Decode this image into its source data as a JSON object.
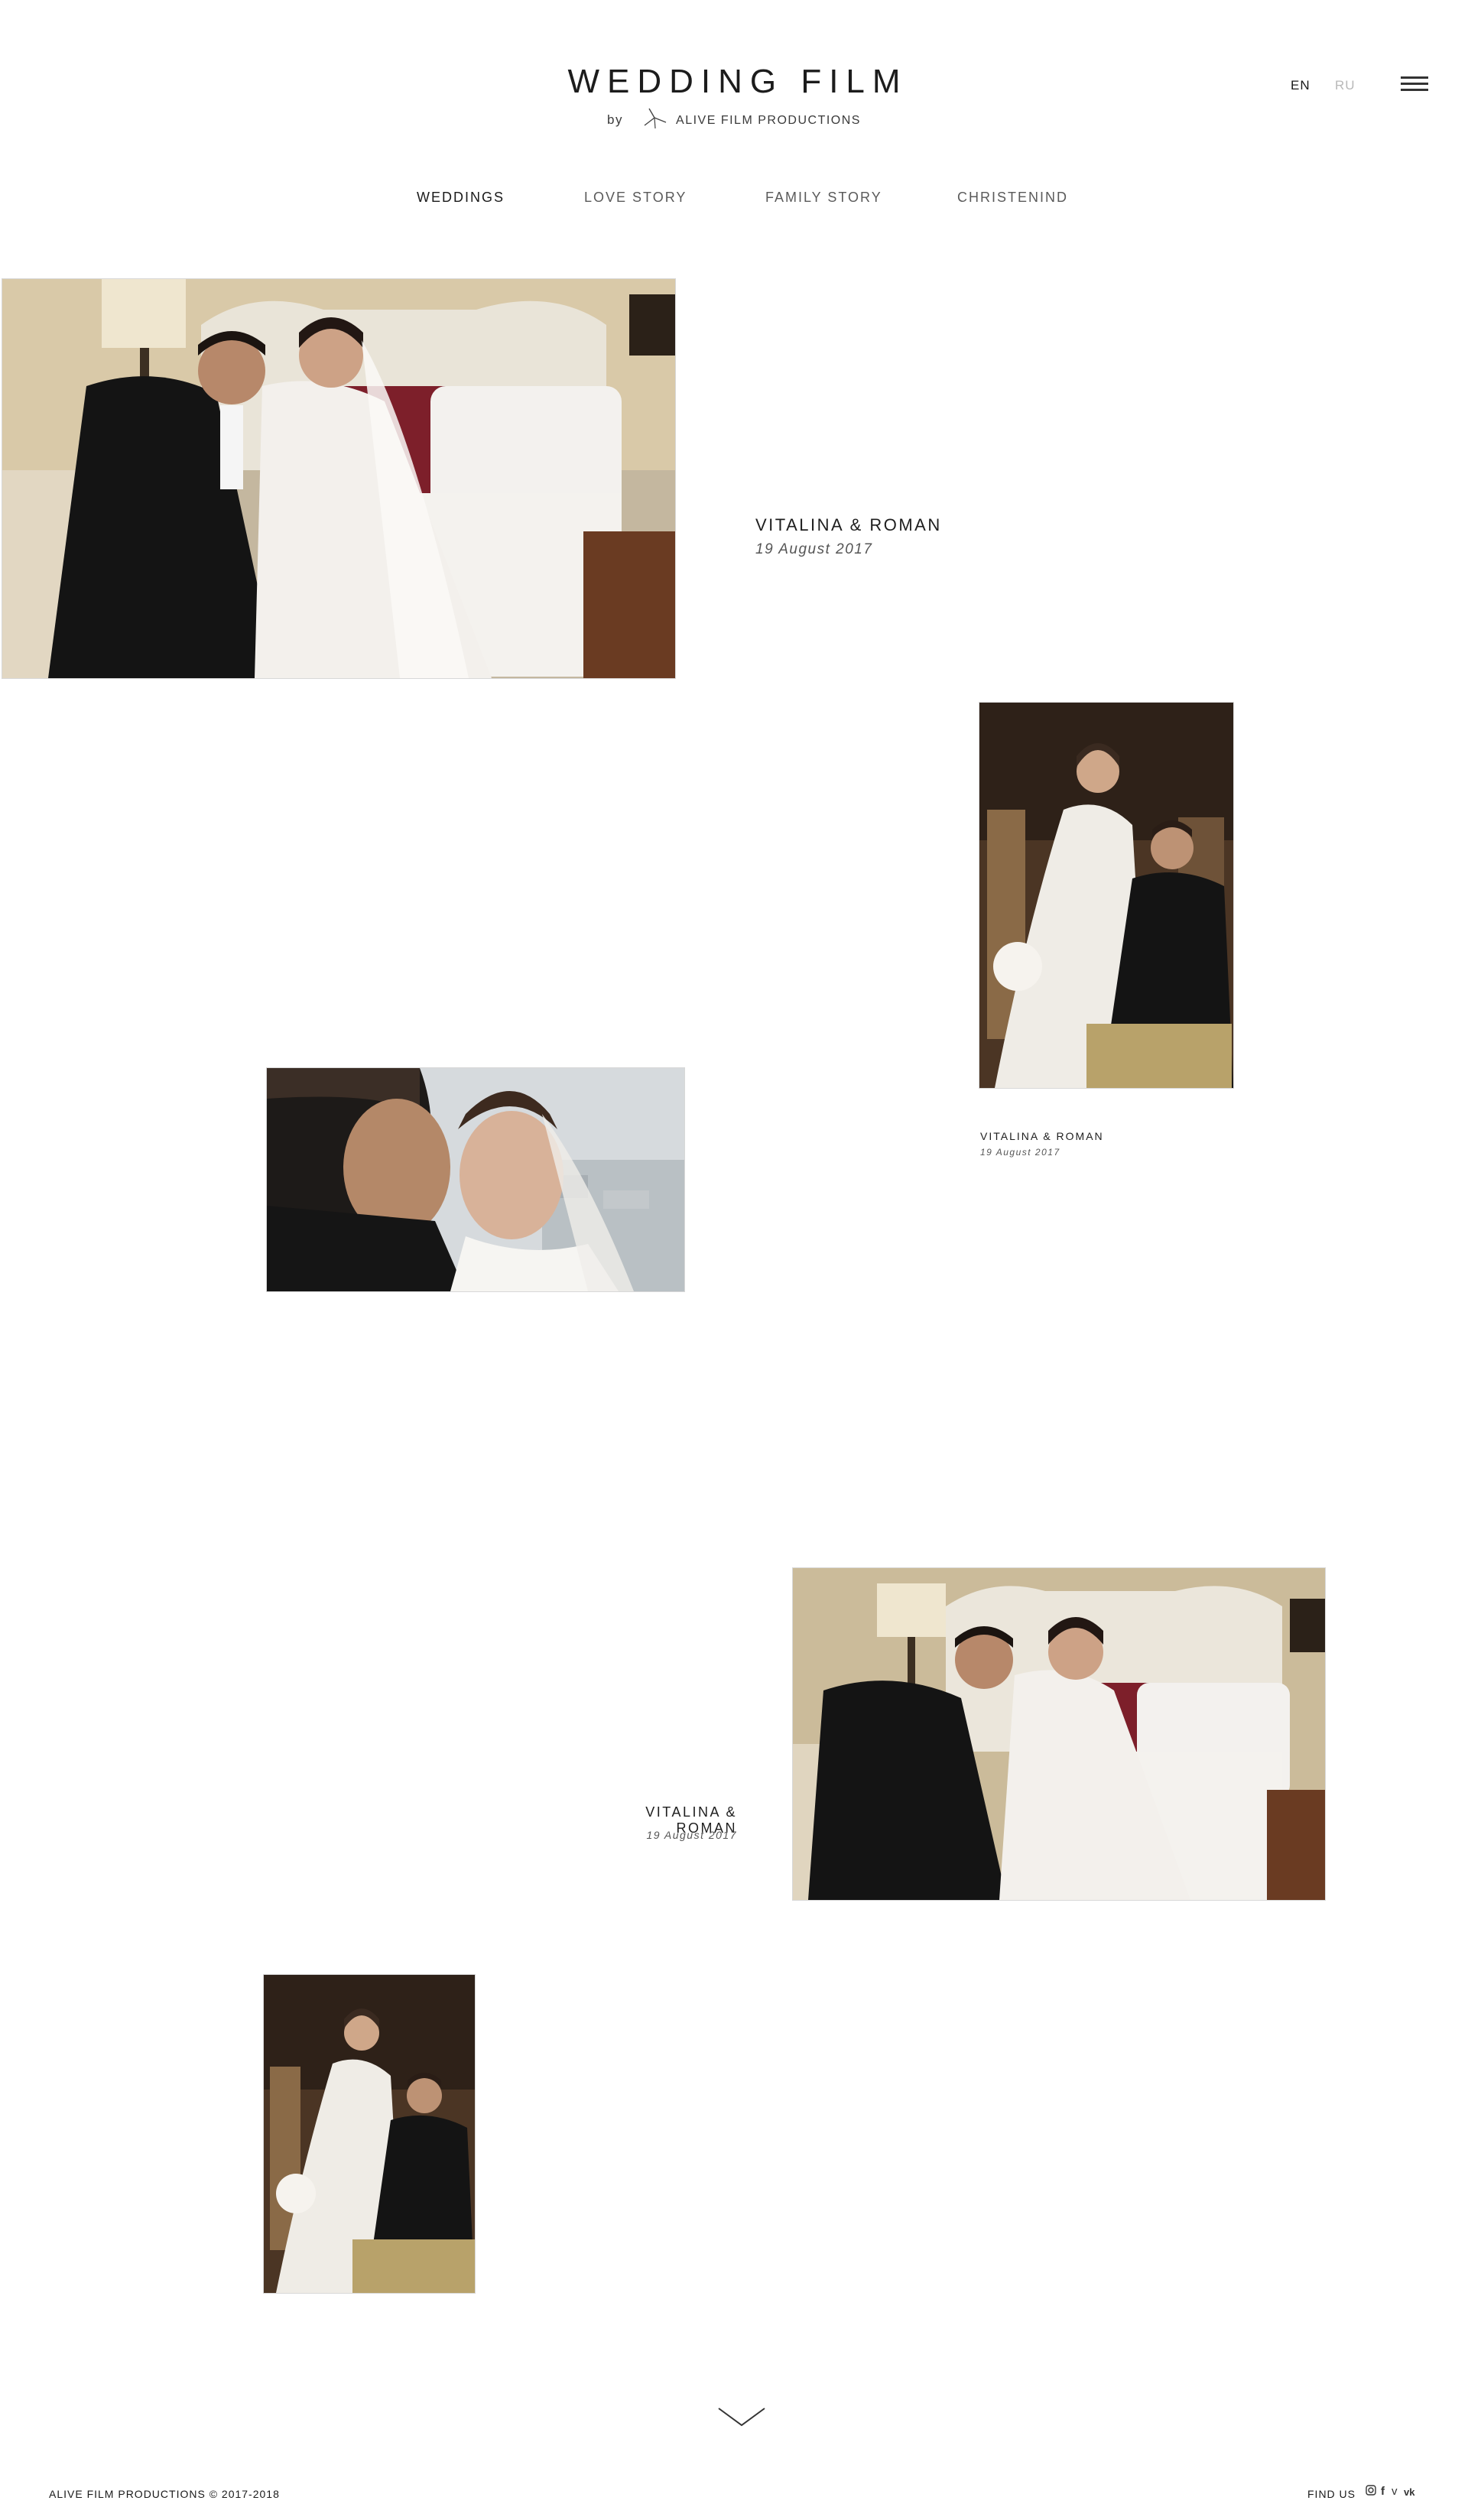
{
  "header": {
    "title": "WEDDING FILM",
    "by": "by",
    "studio": "ALIVE FILM PRODUCTIONS",
    "lang_en": "EN",
    "lang_ru": "RU"
  },
  "nav": {
    "items": [
      {
        "label": "WEDDINGS",
        "active": true
      },
      {
        "label": "LOVE STORY",
        "active": false
      },
      {
        "label": "FAMILY STORY",
        "active": false
      },
      {
        "label": "CHRISTENIND",
        "active": false
      }
    ]
  },
  "gallery": {
    "entries": [
      {
        "title": "VITALINA & ROMAN",
        "date": "19 August 2017"
      },
      {
        "title": "VITALINA & ROMAN",
        "date": "19 August 2017"
      },
      {
        "title": "VITALINA & ROMAN",
        "date": "19 August 2017"
      }
    ]
  },
  "footer": {
    "copyright": "ALIVE FILM PRODUCTIONS © 2017-2018",
    "find_us": "FIND US",
    "social_icons": [
      "instagram-icon",
      "facebook-icon",
      "vimeo-icon",
      "vk-icon"
    ]
  },
  "colors": {
    "text": "#1a1a1a",
    "inactive_lang": "#b8b8b8",
    "background": "#ffffff"
  }
}
